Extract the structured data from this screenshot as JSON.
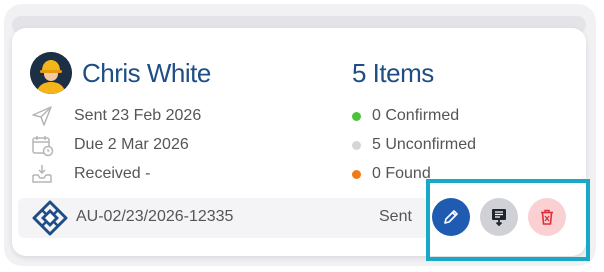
{
  "customer": {
    "name": "Chris White"
  },
  "summary": {
    "items": "5 Items"
  },
  "dates": {
    "sent": "Sent 23 Feb 2026",
    "due": "Due 2 Mar 2026",
    "received": "Received -"
  },
  "statuses": [
    {
      "label": "0 Confirmed",
      "color": "#4cc33a"
    },
    {
      "label": "5 Unconfirmed",
      "color": "#d6d6d6"
    },
    {
      "label": "0 Found",
      "color": "#f07a1a"
    }
  ],
  "footer": {
    "reference": "AU-02/23/2026-12335",
    "status": "Sent"
  },
  "actions": {
    "edit_icon": "pencil-icon",
    "invoice_icon": "invoice-download-icon",
    "delete_icon": "trash-icon"
  },
  "colors": {
    "accent": "#1f4e86",
    "highlight": "#19a9c6",
    "edit": "#1f5bb0",
    "delete_bg": "#fbd0d2",
    "delete_fg": "#e0303a"
  }
}
